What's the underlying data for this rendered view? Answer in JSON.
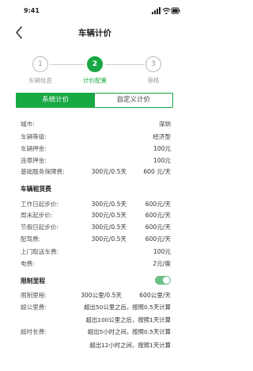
{
  "status": {
    "time": "9:41"
  },
  "nav": {
    "title": "车辆计价"
  },
  "steps": [
    {
      "num": "1",
      "label": "车辆信息"
    },
    {
      "num": "2",
      "label": "计价配置"
    },
    {
      "num": "3",
      "label": "审核"
    }
  ],
  "tabs": {
    "system": "系统计价",
    "custom": "自定义计价"
  },
  "basic": {
    "city": {
      "label": "城市:",
      "value": "深圳"
    },
    "level": {
      "label": "车辆等级:",
      "value": "经济型"
    },
    "deposit": {
      "label": "车辆押金:",
      "value": "100元"
    },
    "violation": {
      "label": "违章押金:",
      "value": "100元"
    },
    "insurance": {
      "label": "基础服务保障费:",
      "v1": "300元/0.5天",
      "v2": "600 元/天"
    }
  },
  "rent": {
    "title": "车辆租赁费",
    "workday": {
      "label": "工作日起步价:",
      "v1": "300元/0.5天",
      "v2": "600元/天"
    },
    "weekend": {
      "label": "周末起步价:",
      "v1": "300元/0.5天",
      "v2": "600元/天"
    },
    "holiday": {
      "label": "节假日起步价:",
      "v1": "300元/0.5天",
      "v2": "600元/天"
    },
    "driver": {
      "label": "配驾费:",
      "v1": "300元/0.5天",
      "v2": "600元/天"
    },
    "pickup": {
      "label": "上门取送车费:",
      "value": "100元"
    },
    "electric": {
      "label": "电费:",
      "value": "2元/度"
    }
  },
  "mileage": {
    "title": "限制里程",
    "toggle_on": true,
    "limit": {
      "label": "限制里程:",
      "v1": "300公里/0.5天",
      "v2": "600公里/天"
    },
    "over_km": {
      "label": "超公里费:",
      "line1": "超出50公里之后，按照0.5天计算",
      "line2": "超出100公里之后，按照1天计算"
    },
    "over_time": {
      "label": "超时长费:",
      "line1": "超出5小时之间，按照0.5天计算",
      "line2": "超出12小时之间，按照1天计算"
    }
  },
  "colors": {
    "accent": "#18a844",
    "toggle": "#6cc185"
  }
}
